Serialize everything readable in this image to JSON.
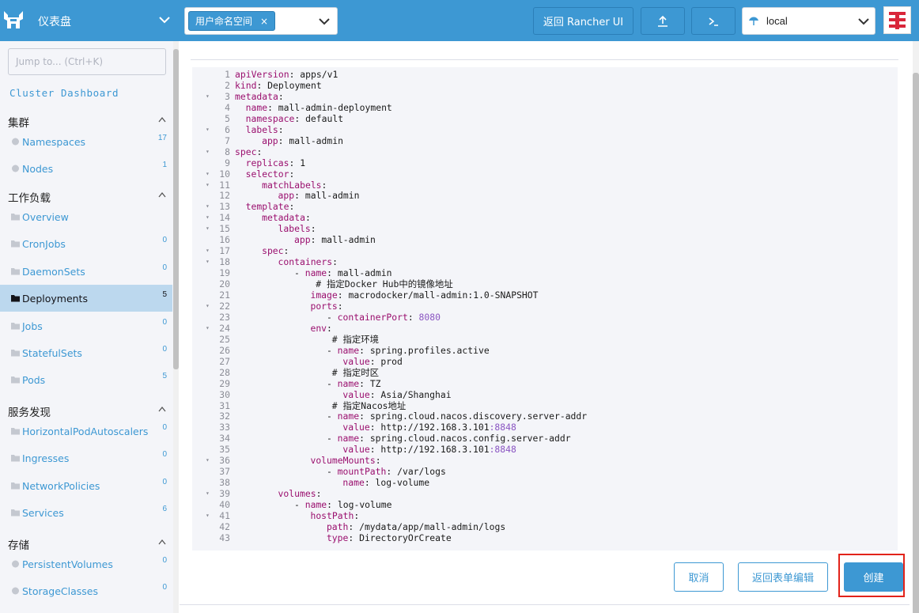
{
  "header": {
    "title": "仪表盘",
    "namespace_chip": "用户命名空间",
    "namespace_remove": "×",
    "back_rancher": "返回 Rancher UI",
    "upload_icon": "upload-icon",
    "shell_icon": "kubectl-shell-icon",
    "cluster": "local",
    "accent": "#3d98d3"
  },
  "sidebar": {
    "jump_placeholder": "Jump to... (Ctrl+K)",
    "cluster_dashboard": "Cluster Dashboard",
    "groups": [
      {
        "label": "集群",
        "items": [
          {
            "label": "Namespaces",
            "count": "17"
          },
          {
            "label": "Nodes",
            "count": "1"
          }
        ]
      },
      {
        "label": "工作负载",
        "items": [
          {
            "label": "Overview",
            "count": ""
          },
          {
            "label": "CronJobs",
            "count": "0"
          },
          {
            "label": "DaemonSets",
            "count": "0"
          },
          {
            "label": "Deployments",
            "count": "5"
          },
          {
            "label": "Jobs",
            "count": "0"
          },
          {
            "label": "StatefulSets",
            "count": "0"
          },
          {
            "label": "Pods",
            "count": "5"
          }
        ]
      },
      {
        "label": "服务发现",
        "items": [
          {
            "label": "HorizontalPodAutoscalers",
            "count": "0"
          },
          {
            "label": "Ingresses",
            "count": "0"
          },
          {
            "label": "NetworkPolicies",
            "count": "0"
          },
          {
            "label": "Services",
            "count": "6"
          }
        ]
      },
      {
        "label": "存储",
        "items": [
          {
            "label": "PersistentVolumes",
            "count": "0"
          },
          {
            "label": "StorageClasses",
            "count": "0"
          }
        ]
      }
    ],
    "active_item": "Deployments"
  },
  "editor": {
    "lines": [
      {
        "n": "1",
        "fold": false,
        "indent": 0,
        "key": "apiVersion",
        "val": "apps/v1"
      },
      {
        "n": "2",
        "fold": false,
        "indent": 0,
        "key": "kind",
        "val": "Deployment"
      },
      {
        "n": "3",
        "fold": true,
        "indent": 0,
        "key": "metadata",
        "val": ""
      },
      {
        "n": "4",
        "fold": false,
        "indent": 2,
        "key": "name",
        "val": "mall-admin-deployment"
      },
      {
        "n": "5",
        "fold": false,
        "indent": 2,
        "key": "namespace",
        "val": "default"
      },
      {
        "n": "6",
        "fold": true,
        "indent": 2,
        "key": "labels",
        "val": ""
      },
      {
        "n": "7",
        "fold": false,
        "indent": 5,
        "key": "app",
        "val": "mall-admin"
      },
      {
        "n": "8",
        "fold": true,
        "indent": 0,
        "key": "spec",
        "val": ""
      },
      {
        "n": "9",
        "fold": false,
        "indent": 2,
        "key": "replicas",
        "val": "1"
      },
      {
        "n": "10",
        "fold": true,
        "indent": 2,
        "key": "selector",
        "val": ""
      },
      {
        "n": "11",
        "fold": true,
        "indent": 5,
        "key": "matchLabels",
        "val": ""
      },
      {
        "n": "12",
        "fold": false,
        "indent": 8,
        "key": "app",
        "val": "mall-admin"
      },
      {
        "n": "13",
        "fold": true,
        "indent": 2,
        "key": "template",
        "val": ""
      },
      {
        "n": "14",
        "fold": true,
        "indent": 5,
        "key": "metadata",
        "val": ""
      },
      {
        "n": "15",
        "fold": true,
        "indent": 8,
        "key": "labels",
        "val": ""
      },
      {
        "n": "16",
        "fold": false,
        "indent": 11,
        "key": "app",
        "val": "mall-admin"
      },
      {
        "n": "17",
        "fold": true,
        "indent": 5,
        "key": "spec",
        "val": ""
      },
      {
        "n": "18",
        "fold": true,
        "indent": 8,
        "key": "containers",
        "val": ""
      },
      {
        "n": "19",
        "fold": false,
        "indent": 11,
        "dash": true,
        "key": "name",
        "val": "mall-admin"
      },
      {
        "n": "20",
        "fold": false,
        "indent": 15,
        "comment": "# 指定Docker Hub中的镜像地址"
      },
      {
        "n": "21",
        "fold": false,
        "indent": 14,
        "key": "image",
        "val": "macrodocker/mall-admin:1.0-SNAPSHOT"
      },
      {
        "n": "22",
        "fold": true,
        "indent": 14,
        "key": "ports",
        "val": ""
      },
      {
        "n": "23",
        "fold": false,
        "indent": 17,
        "dash": true,
        "key": "containerPort",
        "val": "8080",
        "numeric": true
      },
      {
        "n": "24",
        "fold": true,
        "indent": 14,
        "key": "env",
        "val": ""
      },
      {
        "n": "25",
        "fold": false,
        "indent": 18,
        "comment": "# 指定环境"
      },
      {
        "n": "26",
        "fold": false,
        "indent": 17,
        "dash": true,
        "key": "name",
        "val": "spring.profiles.active"
      },
      {
        "n": "27",
        "fold": false,
        "indent": 20,
        "key": "value",
        "val": "prod"
      },
      {
        "n": "28",
        "fold": false,
        "indent": 18,
        "comment": "# 指定时区"
      },
      {
        "n": "29",
        "fold": false,
        "indent": 17,
        "dash": true,
        "key": "name",
        "val": "TZ"
      },
      {
        "n": "30",
        "fold": false,
        "indent": 20,
        "key": "value",
        "val": "Asia/Shanghai"
      },
      {
        "n": "31",
        "fold": false,
        "indent": 18,
        "comment": "# 指定Nacos地址"
      },
      {
        "n": "32",
        "fold": false,
        "indent": 17,
        "dash": true,
        "key": "name",
        "val": "spring.cloud.nacos.discovery.server-addr"
      },
      {
        "n": "33",
        "fold": false,
        "indent": 20,
        "key": "value",
        "val": "http://192.168.3.101",
        "port": ":8848"
      },
      {
        "n": "34",
        "fold": false,
        "indent": 17,
        "dash": true,
        "key": "name",
        "val": "spring.cloud.nacos.config.server-addr"
      },
      {
        "n": "35",
        "fold": false,
        "indent": 20,
        "key": "value",
        "val": "http://192.168.3.101",
        "port": ":8848"
      },
      {
        "n": "36",
        "fold": true,
        "indent": 14,
        "key": "volumeMounts",
        "val": ""
      },
      {
        "n": "37",
        "fold": false,
        "indent": 17,
        "dash": true,
        "key": "mountPath",
        "val": "/var/logs"
      },
      {
        "n": "38",
        "fold": false,
        "indent": 20,
        "key": "name",
        "val": "log-volume"
      },
      {
        "n": "39",
        "fold": true,
        "indent": 8,
        "key": "volumes",
        "val": ""
      },
      {
        "n": "40",
        "fold": false,
        "indent": 11,
        "dash": true,
        "key": "name",
        "val": "log-volume"
      },
      {
        "n": "41",
        "fold": true,
        "indent": 14,
        "key": "hostPath",
        "val": ""
      },
      {
        "n": "42",
        "fold": false,
        "indent": 17,
        "key": "path",
        "val": "/mydata/app/mall-admin/logs"
      },
      {
        "n": "43",
        "fold": false,
        "indent": 17,
        "key": "type",
        "val": "DirectoryOrCreate"
      }
    ]
  },
  "footer": {
    "cancel": "取消",
    "back_form": "返回表单编辑",
    "create": "创建",
    "highlight_color": "#e2231a"
  }
}
